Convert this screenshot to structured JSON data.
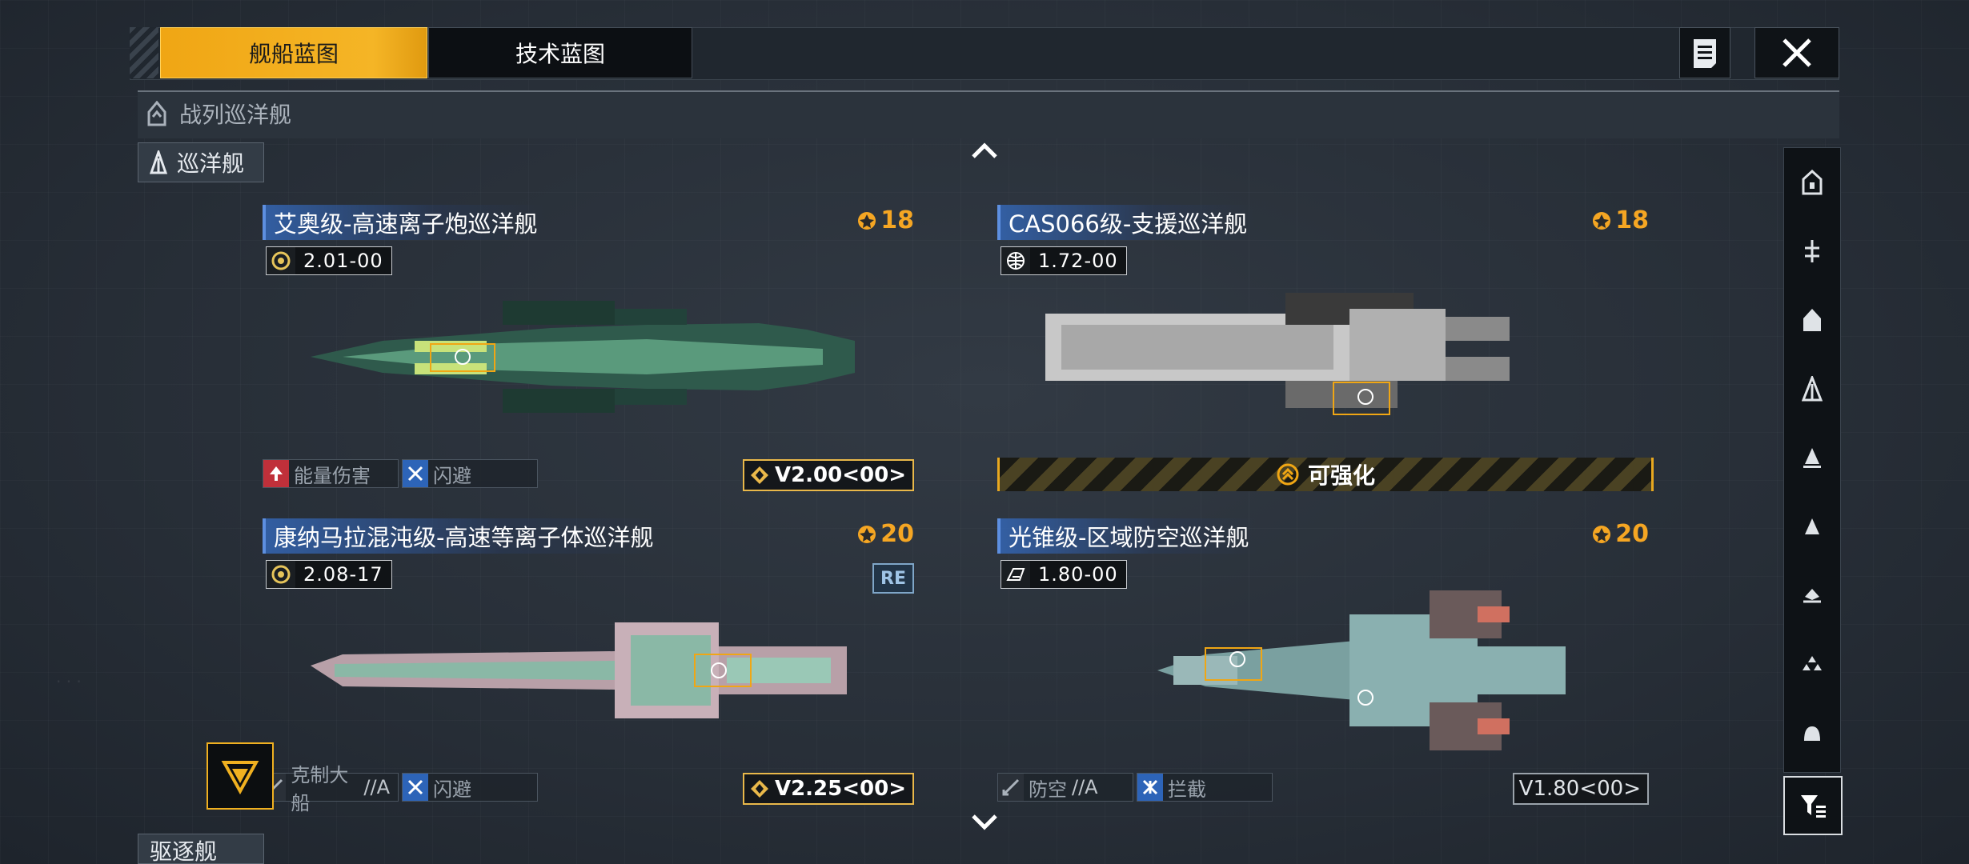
{
  "top_tabs": {
    "active_label": "舰船蓝图",
    "inactive_label": "技术蓝图"
  },
  "category": {
    "label": "战列巡洋舰",
    "subcategory": "巡洋舰",
    "next_subcategory": "驱逐舰"
  },
  "cards": [
    {
      "title": "艾奥级-高速离子炮巡洋舰",
      "cost": "18",
      "version": "2.01-00",
      "tags": [
        {
          "icon": "energy-damage-icon",
          "label": "能量伤害"
        },
        {
          "icon": "evade-icon",
          "label": "闪避"
        }
      ],
      "blueprint": "V2.00<00>",
      "accent": "#5a9a7c"
    },
    {
      "title": "CAS066级-支援巡洋舰",
      "cost": "18",
      "version": "1.72-00",
      "upgrade": "可强化",
      "accent": "#c8c8c8"
    },
    {
      "title": "康纳马拉混沌级-高速等离子体巡洋舰",
      "cost": "20",
      "version": "2.08-17",
      "badge": "RE",
      "tags": [
        {
          "icon": "counter-capital-icon",
          "label": "克制大船",
          "suffix": "//A"
        },
        {
          "icon": "evade-icon",
          "label": "闪避"
        }
      ],
      "blueprint": "V2.25<00>",
      "accent": "#8ab8a6"
    },
    {
      "title": "光锥级-区域防空巡洋舰",
      "cost": "20",
      "version": "1.80-00",
      "tags": [
        {
          "icon": "anti-air-icon",
          "label": "防空",
          "suffix": "//A"
        },
        {
          "icon": "intercept-icon",
          "label": "拦截"
        }
      ],
      "blueprint": "V1.80<00>",
      "accent": "#8ab0b0"
    }
  ],
  "filters": [
    "ship-type-1-icon",
    "ship-type-2-icon",
    "ship-type-3-icon",
    "ship-type-4-icon",
    "ship-type-5-icon",
    "ship-type-6-icon",
    "ship-type-7-icon",
    "ship-type-8-icon",
    "ship-type-9-icon"
  ],
  "colors": {
    "accent": "#f0a614",
    "title_blue": "#3466b4",
    "cost": "#f5a623"
  }
}
